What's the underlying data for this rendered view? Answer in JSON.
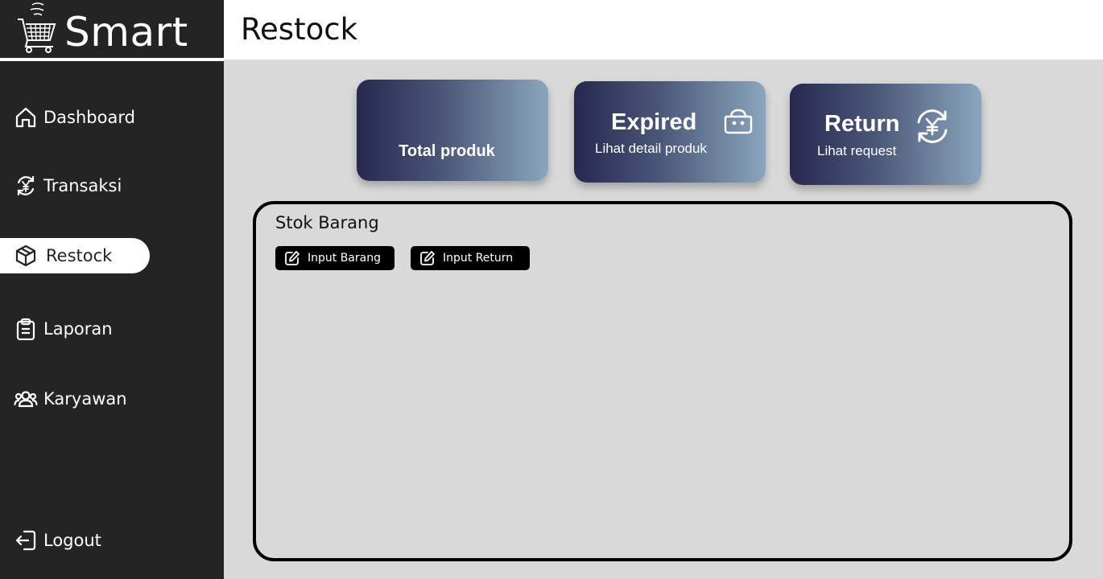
{
  "brand": {
    "name": "Smart",
    "logo_icon": "shopping-cart-icon"
  },
  "header": {
    "title": "Restock"
  },
  "sidebar": {
    "items": [
      {
        "label": "Dashboard",
        "icon": "home-icon"
      },
      {
        "label": "Transaksi",
        "icon": "yen-exchange-icon"
      },
      {
        "label": "Restock",
        "icon": "box-icon",
        "active": true
      },
      {
        "label": "Laporan",
        "icon": "clipboard-icon"
      },
      {
        "label": "Karyawan",
        "icon": "users-icon"
      }
    ],
    "logout": {
      "label": "Logout",
      "icon": "logout-icon"
    }
  },
  "cards": [
    {
      "title": "",
      "subtitle": "Total produk"
    },
    {
      "title": "Expired",
      "subtitle": "Lihat detail produk",
      "icon": "basket-icon"
    },
    {
      "title": "Return",
      "subtitle": "Lihat request",
      "icon": "yen-exchange-icon"
    }
  ],
  "panel": {
    "title": "Stok Barang",
    "buttons": [
      {
        "label": "Input Barang",
        "icon": "edit-icon"
      },
      {
        "label": "Input Return",
        "icon": "edit-icon"
      }
    ]
  },
  "colors": {
    "sidebar_bg": "#242424",
    "content_bg": "#d9d9d9",
    "card_gradient_start": "#27284f",
    "card_gradient_end": "#8aa6bd",
    "button_bg": "#000000"
  }
}
